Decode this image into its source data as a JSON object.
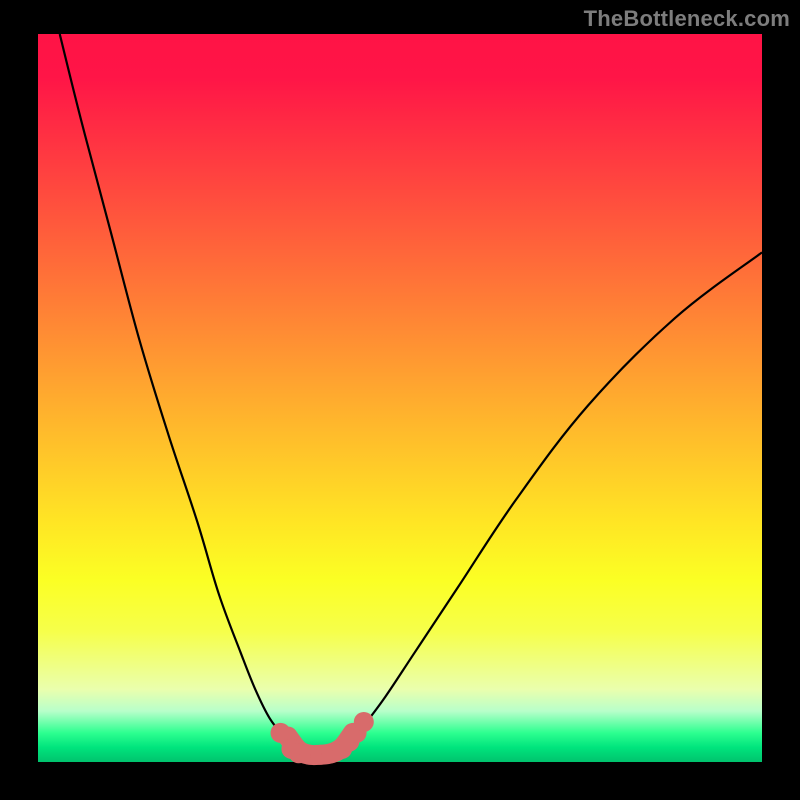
{
  "watermark": "TheBottleneck.com",
  "colors": {
    "frame": "#000000",
    "curve": "#000000",
    "marker": "#d86b6b",
    "gradient_top": "#ff1346",
    "gradient_bottom": "#00c36d"
  },
  "chart_data": {
    "type": "line",
    "title": "",
    "xlabel": "",
    "ylabel": "",
    "xlim": [
      0,
      100
    ],
    "ylim": [
      0,
      100
    ],
    "series": [
      {
        "name": "left-curve",
        "x": [
          3,
          6,
          10,
          14,
          18,
          22,
          25,
          28,
          30,
          32,
          34,
          35.5,
          37
        ],
        "y": [
          100,
          88,
          73,
          58,
          45,
          33,
          23,
          15,
          10,
          6,
          3.5,
          2,
          1
        ]
      },
      {
        "name": "right-curve",
        "x": [
          41,
          43,
          45,
          48,
          52,
          58,
          66,
          76,
          88,
          100
        ],
        "y": [
          1,
          2.5,
          5,
          9,
          15,
          24,
          36,
          49,
          61,
          70
        ]
      }
    ],
    "markers": {
      "name": "highlight-points",
      "x": [
        33.5,
        35,
        36,
        37.5,
        39,
        40.5,
        42,
        43,
        44,
        45
      ],
      "y": [
        4,
        1.8,
        1.2,
        1,
        1,
        1.2,
        1.8,
        2.8,
        4,
        5.5
      ]
    },
    "valley_path": {
      "x": [
        34.5,
        36,
        37.5,
        39,
        40.5,
        42,
        43.5
      ],
      "y": [
        3.5,
        1.6,
        1,
        1,
        1.2,
        2,
        4
      ]
    }
  }
}
